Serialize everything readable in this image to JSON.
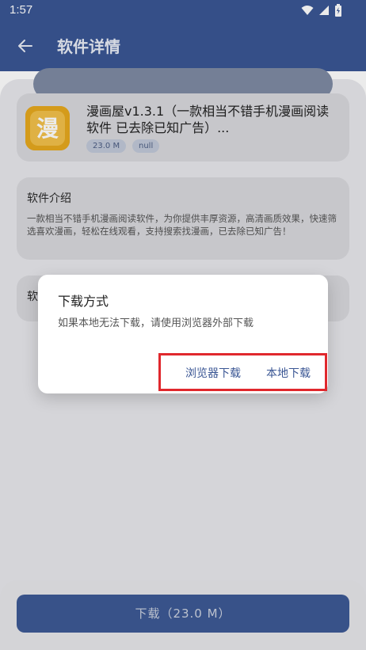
{
  "status_bar": {
    "time": "1:57"
  },
  "header": {
    "title": "软件详情"
  },
  "app": {
    "name": "漫画屋v1.3.1（一款相当不错手机漫画阅读软件 已去除已知广告）...",
    "icon_glyph": "漫",
    "size_tag": "23.0 M",
    "extra_tag": "null"
  },
  "intro": {
    "title": "软件介绍",
    "text": "一款相当不错手机漫画阅读软件，为你提供丰厚资源，高清画质效果，快速筛选喜欢漫画，轻松在线观看，支持搜索找漫画，已去除已知广告！"
  },
  "third_section": {
    "title": "软"
  },
  "download_button": {
    "label": "下载（23.0 M）"
  },
  "dialog": {
    "title": "下载方式",
    "message": "如果本地无法下载，请使用浏览器外部下载",
    "browser_button": "浏览器下载",
    "local_button": "本地下载"
  },
  "colors": {
    "primary": "#3a5694",
    "highlight_box": "#e0282d",
    "app_icon": "#e6a91e"
  }
}
